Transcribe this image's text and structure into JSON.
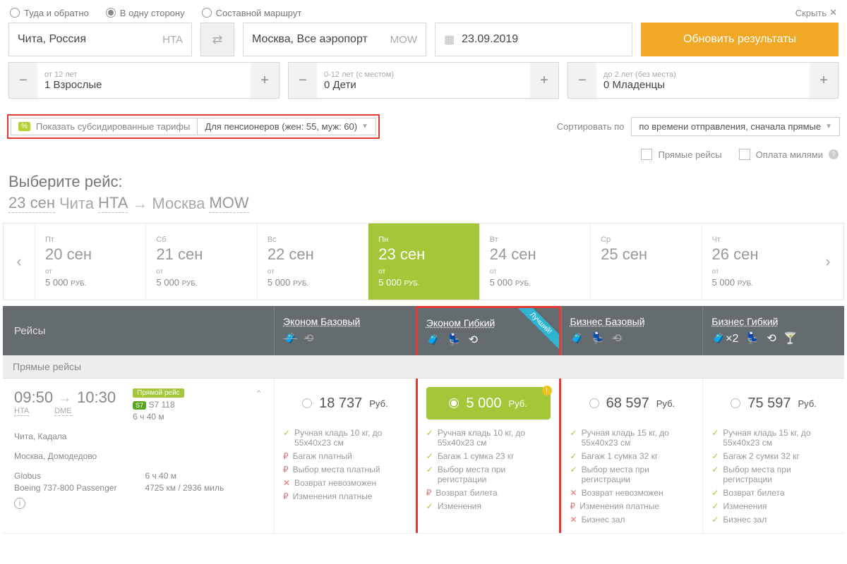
{
  "tripTypes": {
    "a": "Туда и обратно",
    "b": "В одну сторону",
    "c": "Составной маршрут"
  },
  "hide": "Скрыть",
  "from": {
    "city": "Чита, Россия",
    "code": "HTA"
  },
  "to": {
    "city": "Москва, Все аэропорт",
    "code": "MOW"
  },
  "date": "23.09.2019",
  "updateBtn": "Обновить результаты",
  "pax": {
    "adult": {
      "hint": "от 12 лет",
      "val": "1 Взрослые"
    },
    "child": {
      "hint": "0-12 лет (с местом)",
      "val": "0 Дети"
    },
    "infant": {
      "hint": "до 2 лет (без места)",
      "val": "0 Младенцы"
    }
  },
  "subsidized": {
    "label": "Показать субсидированные тарифы",
    "selected": "Для пенсионеров (жен: 55, муж: 60)"
  },
  "sort": {
    "label": "Сортировать по",
    "value": "по времени отправления, сначала прямые"
  },
  "checks": {
    "direct": "Прямые рейсы",
    "miles": "Оплата милями"
  },
  "selectFlight": "Выберите рейс:",
  "route": {
    "date": "23 сен",
    "from": "Чита",
    "fromCode": "HTA",
    "to": "Москва",
    "toCode": "MOW"
  },
  "days": [
    {
      "dow": "Пт",
      "d": "20 сен",
      "from": "от",
      "price": "5 000",
      "curr": "РУБ."
    },
    {
      "dow": "Сб",
      "d": "21 сен",
      "from": "от",
      "price": "5 000",
      "curr": "РУБ."
    },
    {
      "dow": "Вс",
      "d": "22 сен",
      "from": "от",
      "price": "5 000",
      "curr": "РУБ."
    },
    {
      "dow": "Пн",
      "d": "23 сен",
      "from": "от",
      "price": "5 000",
      "curr": "РУБ."
    },
    {
      "dow": "Вт",
      "d": "24 сен",
      "from": "от",
      "price": "5 000",
      "curr": "РУБ."
    },
    {
      "dow": "Ср",
      "d": "25 сен",
      "from": "",
      "price": "",
      "curr": ""
    },
    {
      "dow": "Чт",
      "d": "26 сен",
      "from": "от",
      "price": "5 000",
      "curr": "РУБ."
    }
  ],
  "fareHeader": {
    "left": "Рейсы",
    "cols": [
      "Эконом Базовый",
      "Эконом Гибкий",
      "Бизнес Базовый",
      "Бизнес Гибкий"
    ],
    "best": "Лучший!"
  },
  "directLabel": "Прямые рейсы",
  "flight": {
    "dep": "09:50",
    "arr": "10:30",
    "depCode": "HTA",
    "arrCode": "DME",
    "directBadge": "Прямой рейс",
    "flightNo": "S7 118",
    "dur": "6 ч 40 м",
    "fromAirport": "Чита, Кадала",
    "toAirport": "Москва, Домодедово",
    "carrier": "Globus",
    "aircraft": "Boeing 737-800 Passenger",
    "dur2": "6 ч 40 м",
    "dist": "4725 км / 2936 миль",
    "s7": "S7"
  },
  "prices": [
    "18 737",
    "5 000",
    "68 597",
    "75 597"
  ],
  "currency": "Руб.",
  "features": {
    "basic": [
      {
        "i": "ok",
        "t": "Ручная кладь 10 кг, до 55x40x23 см"
      },
      {
        "i": "p",
        "t": "Багаж платный"
      },
      {
        "i": "p",
        "t": "Выбор места платный"
      },
      {
        "i": "no",
        "t": "Возврат невозможен"
      },
      {
        "i": "p",
        "t": "Изменения платные"
      }
    ],
    "flex": [
      {
        "i": "ok",
        "t": "Ручная кладь 10 кг, до 55x40x23 см"
      },
      {
        "i": "ok",
        "t": "Багаж 1 сумка 23 кг"
      },
      {
        "i": "ok",
        "t": "Выбор места при регистрации"
      },
      {
        "i": "p",
        "t": "Возврат билета"
      },
      {
        "i": "ok",
        "t": "Изменения"
      }
    ],
    "bizbasic": [
      {
        "i": "ok",
        "t": "Ручная кладь 15 кг, до 55x40x23 см"
      },
      {
        "i": "ok",
        "t": "Багаж 1 сумка 32 кг"
      },
      {
        "i": "ok",
        "t": "Выбор места при регистрации"
      },
      {
        "i": "no",
        "t": "Возврат невозможен"
      },
      {
        "i": "p",
        "t": "Изменения платные"
      },
      {
        "i": "no",
        "t": "Бизнес зал"
      }
    ],
    "bizflex": [
      {
        "i": "ok",
        "t": "Ручная кладь 15 кг, до 55x40x23 см"
      },
      {
        "i": "ok",
        "t": "Багаж 2 сумки 32 кг"
      },
      {
        "i": "ok",
        "t": "Выбор места при регистрации"
      },
      {
        "i": "ok",
        "t": "Возврат билета"
      },
      {
        "i": "ok",
        "t": "Изменения"
      },
      {
        "i": "ok",
        "t": "Бизнес зал"
      }
    ]
  }
}
